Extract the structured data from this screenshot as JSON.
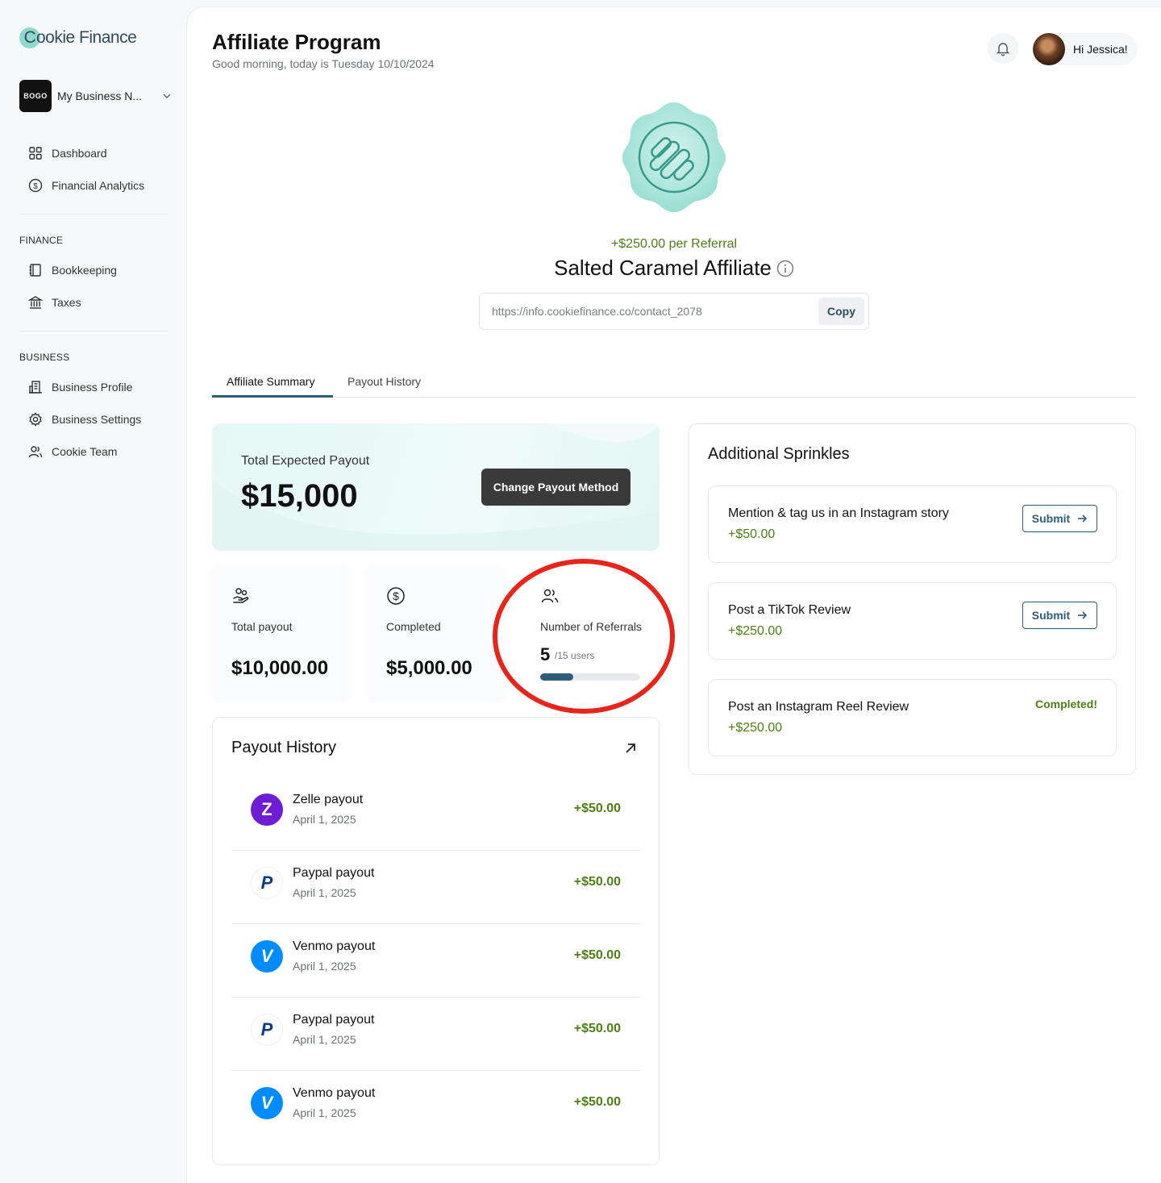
{
  "brand": {
    "name": "ookie Finance",
    "initial": "C",
    "accent": "#2f5c7a",
    "positive": "#4d7f12",
    "alert": "#e8251a"
  },
  "business": {
    "logo_text": "BOGO",
    "name": "My Business N..."
  },
  "sidebar": {
    "top_items": [
      {
        "label": "Dashboard",
        "icon": "grid-icon"
      },
      {
        "label": "Financial Analytics",
        "icon": "dollar-circle-icon"
      }
    ],
    "finance_label": "FINANCE",
    "finance_items": [
      {
        "label": "Bookkeeping",
        "icon": "book-icon"
      },
      {
        "label": "Taxes",
        "icon": "bank-icon"
      }
    ],
    "business_label": "BUSINESS",
    "business_items": [
      {
        "label": "Business Profile",
        "icon": "building-icon"
      },
      {
        "label": "Business Settings",
        "icon": "gear-icon"
      },
      {
        "label": "Cookie Team",
        "icon": "team-icon"
      }
    ]
  },
  "header": {
    "title": "Affiliate Program",
    "greeting": "Good morning, today is Tuesday 10/10/2024",
    "user_greeting": "Hi Jessica!"
  },
  "affiliate": {
    "per_referral": "+$250.00 per Referral",
    "name": "Salted Caramel Affiliate",
    "link": "https://info.cookiefinance.co/contact_2078",
    "copy_label": "Copy"
  },
  "tabs": [
    "Affiliate Summary",
    "Payout History"
  ],
  "expected": {
    "label": "Total Expected Payout",
    "amount": "$15,000",
    "button": "Change Payout Method"
  },
  "stats": {
    "total_payout": {
      "label": "Total payout",
      "value": "$10,000.00"
    },
    "completed": {
      "label": "Completed",
      "value": "$5,000.00"
    },
    "referrals": {
      "label": "Number of Referrals",
      "count": "5",
      "total": "/15 users",
      "progress": 0.33
    }
  },
  "history": {
    "title": "Payout History",
    "rows": [
      {
        "method": "zelle",
        "title": "Zelle payout",
        "date": "April 1, 2025",
        "amount": "+$50.00"
      },
      {
        "method": "paypal",
        "title": "Paypal payout",
        "date": "April 1, 2025",
        "amount": "+$50.00"
      },
      {
        "method": "venmo",
        "title": "Venmo payout",
        "date": "April 1, 2025",
        "amount": "+$50.00"
      },
      {
        "method": "paypal",
        "title": "Paypal payout",
        "date": "April 1, 2025",
        "amount": "+$50.00"
      },
      {
        "method": "venmo",
        "title": "Venmo payout",
        "date": "April 1, 2025",
        "amount": "+$50.00"
      }
    ]
  },
  "sprinkles": {
    "title": "Additional Sprinkles",
    "submit_label": "Submit",
    "items": [
      {
        "title": "Mention & tag us in an Instagram story",
        "amount": "+$50.00"
      },
      {
        "title": "Post a TikTok Review",
        "amount": "+$250.00"
      },
      {
        "title": "Post an Instagram Reel Review",
        "amount": "+$250.00",
        "status": "Completed!"
      }
    ]
  }
}
